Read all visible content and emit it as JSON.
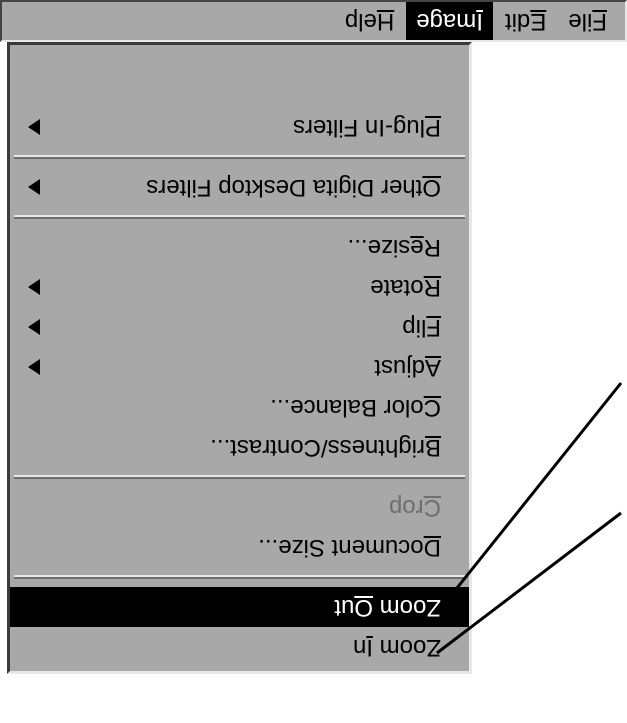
{
  "menubar": {
    "items": [
      {
        "pre": "",
        "ul": "F",
        "post": "ile",
        "active": false
      },
      {
        "pre": "",
        "ul": "E",
        "post": "dit",
        "active": false
      },
      {
        "pre": "",
        "ul": "I",
        "post": "mage",
        "active": true
      },
      {
        "pre": "",
        "ul": "H",
        "post": "elp",
        "active": false
      }
    ]
  },
  "dropdown": {
    "items": [
      {
        "type": "item",
        "pre": "Zoom ",
        "ul": "I",
        "post": "n",
        "highlight": false,
        "disabled": false,
        "submenu": false
      },
      {
        "type": "item",
        "pre": "Zoom ",
        "ul": "O",
        "post": "ut",
        "highlight": true,
        "disabled": false,
        "submenu": false
      },
      {
        "type": "sep"
      },
      {
        "type": "item",
        "pre": "",
        "ul": "D",
        "post": "ocument Size...",
        "highlight": false,
        "disabled": false,
        "submenu": false
      },
      {
        "type": "item",
        "pre": "",
        "ul": "C",
        "post": "rop",
        "highlight": false,
        "disabled": true,
        "submenu": false
      },
      {
        "type": "sep"
      },
      {
        "type": "item",
        "pre": "",
        "ul": "B",
        "post": "rightness/Contrast...",
        "highlight": false,
        "disabled": false,
        "submenu": false
      },
      {
        "type": "item",
        "pre": "",
        "ul": "C",
        "post": "olor Balance...",
        "highlight": false,
        "disabled": false,
        "submenu": false
      },
      {
        "type": "item",
        "pre": "",
        "ul": "A",
        "post": "djust",
        "highlight": false,
        "disabled": false,
        "submenu": true
      },
      {
        "type": "item",
        "pre": "",
        "ul": "F",
        "post": "lip",
        "highlight": false,
        "disabled": false,
        "submenu": true
      },
      {
        "type": "item",
        "pre": "",
        "ul": "R",
        "post": "otate",
        "highlight": false,
        "disabled": false,
        "submenu": true
      },
      {
        "type": "item",
        "pre": "R",
        "ul": "e",
        "post": "size...",
        "highlight": false,
        "disabled": false,
        "submenu": false
      },
      {
        "type": "sep"
      },
      {
        "type": "item",
        "pre": "",
        "ul": "O",
        "post": "ther Digita Desktop Filters",
        "highlight": false,
        "disabled": false,
        "submenu": true
      },
      {
        "type": "sep"
      },
      {
        "type": "item",
        "pre": "",
        "ul": "P",
        "post": "lug-In Filters",
        "highlight": false,
        "disabled": false,
        "submenu": true
      }
    ]
  }
}
